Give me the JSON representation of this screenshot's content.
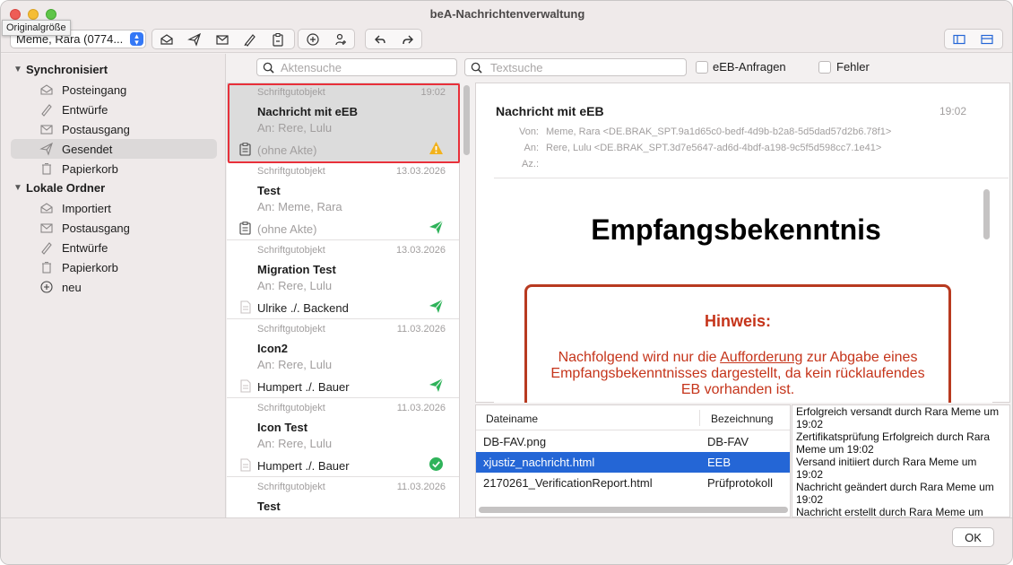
{
  "window": {
    "title": "beA-Nachrichtenverwaltung",
    "tooltip": "Originalgröße"
  },
  "toolbar": {
    "account": "Meme, Rara (0774..."
  },
  "sidebar": {
    "sections": [
      {
        "title": "Synchronisiert",
        "items": [
          {
            "label": "Posteingang",
            "icon": "inbox-icon"
          },
          {
            "label": "Entwürfe",
            "icon": "pencil-icon"
          },
          {
            "label": "Postausgang",
            "icon": "outbox-icon"
          },
          {
            "label": "Gesendet",
            "icon": "paper-plane-icon",
            "selected": true
          },
          {
            "label": "Papierkorb",
            "icon": "trash-icon"
          }
        ]
      },
      {
        "title": "Lokale Ordner",
        "items": [
          {
            "label": "Importiert",
            "icon": "inbox-icon"
          },
          {
            "label": "Postausgang",
            "icon": "outbox-icon"
          },
          {
            "label": "Entwürfe",
            "icon": "pencil-icon"
          },
          {
            "label": "Papierkorb",
            "icon": "trash-icon"
          },
          {
            "label": "neu",
            "icon": "plus-circle-icon"
          }
        ]
      }
    ]
  },
  "search": {
    "akten_placeholder": "Aktensuche",
    "text_placeholder": "Textsuche",
    "eeb_label": "eEB-Anfragen",
    "fehler_label": "Fehler"
  },
  "messages": [
    {
      "type": "Schriftgutobjekt",
      "date": "19:02",
      "subject": "Nachricht mit eEB",
      "to": "An: Rere, Lulu",
      "akte": "(ohne Akte)",
      "status": "warning-icon"
    },
    {
      "type": "Schriftgutobjekt",
      "date": "13.03.2026",
      "subject": "Test",
      "to": "An: Meme, Rara",
      "akte": "(ohne Akte)",
      "status": "sent-icon"
    },
    {
      "type": "Schriftgutobjekt",
      "date": "13.03.2026",
      "subject": "Migration Test",
      "to": "An: Rere, Lulu",
      "akte": "Ulrike ./. Backend",
      "status": "sent-icon"
    },
    {
      "type": "Schriftgutobjekt",
      "date": "11.03.2026",
      "subject": "Icon2",
      "to": "An: Rere, Lulu",
      "akte": "Humpert ./. Bauer",
      "status": "sent-icon"
    },
    {
      "type": "Schriftgutobjekt",
      "date": "11.03.2026",
      "subject": "Icon Test",
      "to": "An: Rere, Lulu",
      "akte": "Humpert ./. Bauer",
      "status": "check-circle-icon"
    },
    {
      "type": "Schriftgutobjekt",
      "date": "11.03.2026",
      "subject": "Test",
      "to": "",
      "akte": "",
      "status": ""
    }
  ],
  "detail": {
    "subject": "Nachricht mit eEB",
    "time": "19:02",
    "von_label": "Von:",
    "von": "Meme, Rara <DE.BRAK_SPT.9a1d65c0-bedf-4d9b-b2a8-5d5dad57d2b6.78f1>",
    "an_label": "An:",
    "an": "Rere, Lulu <DE.BRAK_SPT.3d7e5647-ad6d-4bdf-a198-9c5f5d598cc7.1e41>",
    "az_label": "Az.:",
    "doc_title": "Empfangsbekenntnis",
    "hinweis_title": "Hinweis:",
    "hinweis_pre": "Nachfolgend wird nur die ",
    "hinweis_link": "Aufforderung",
    "hinweis_post": " zur Abgabe eines Empfangsbekenntnisses dargestellt, da kein rücklaufendes EB vorhanden ist."
  },
  "attachments": {
    "col_name": "Dateiname",
    "col_desc": "Bezeichnung",
    "rows": [
      {
        "name": "DB-FAV.png",
        "desc": "DB-FAV"
      },
      {
        "name": "xjustiz_nachricht.html",
        "desc": "EEB"
      },
      {
        "name": "2170261_VerificationReport.html",
        "desc": "Prüfprotokoll"
      }
    ],
    "selected_index": 1
  },
  "log": [
    "Erfolgreich versandt durch Rara Meme um 19:02",
    "Zertifikatsprüfung Erfolgreich durch Rara Meme um 19:02",
    "Versand initiiert durch Rara Meme um 19:02",
    "Nachricht geändert durch Rara Meme um 19:02",
    "Nachricht erstellt durch Rara Meme um"
  ],
  "footer": {
    "ok_label": "OK"
  },
  "colors": {
    "accent": "#2466d6",
    "selection_outline": "#e8303a",
    "notice": "#c5341a",
    "sent": "#2fb35a"
  }
}
